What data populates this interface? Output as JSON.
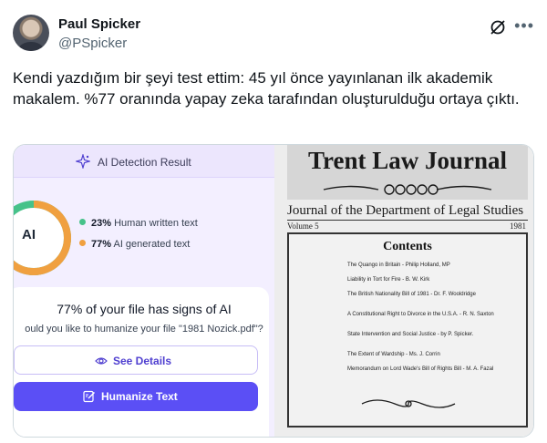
{
  "tweet": {
    "author_name": "Paul Spicker",
    "author_handle": "@PSpicker",
    "text": "Kendi yazdığım bir şeyi test ettim: 45 yıl önce yayınlanan ilk akademik makalem. %77 oranında yapay zeka tarafından oluşturulduğu ortaya çıktı.",
    "more_label": "•••"
  },
  "detector": {
    "header_title": "AI Detection Result",
    "ring_label": "AI",
    "human_percent": "23%",
    "human_label": "Human written text",
    "ai_percent": "77%",
    "ai_label": "AI generated text",
    "ai_fraction": 0.77,
    "summary_title": "77% of your file has signs of AI",
    "summary_sub": "ould you like to humanize your file \"1981 Nozick.pdf\"?",
    "details_button": "See Details",
    "humanize_button": "Humanize Text",
    "colors": {
      "human": "#46c28a",
      "ai": "#f0a040",
      "accent": "#5b4ff5"
    }
  },
  "journal": {
    "title": "Trent Law Journal",
    "subtitle": "Journal of the Department of Legal Studies",
    "volume": "Volume 5",
    "year": "1981",
    "contents_title": "Contents",
    "entries": [
      "The Quango in Britain - Philip Holland, MP",
      "Liability in Tort for Fire - B. W. Kirk",
      "The British Nationality Bill of 1981 - Dr. F. Wooldridge",
      "A Constitutional Right to Divorce in the U.S.A. - R. N. Saxton",
      "State Intervention and Social Justice - by P. Spicker.",
      "The Extent of Wardship - Ms. J. Corrin",
      "Memorandum on Lord Wade's Bill of Rights Bill - M. A. Fazal"
    ]
  }
}
